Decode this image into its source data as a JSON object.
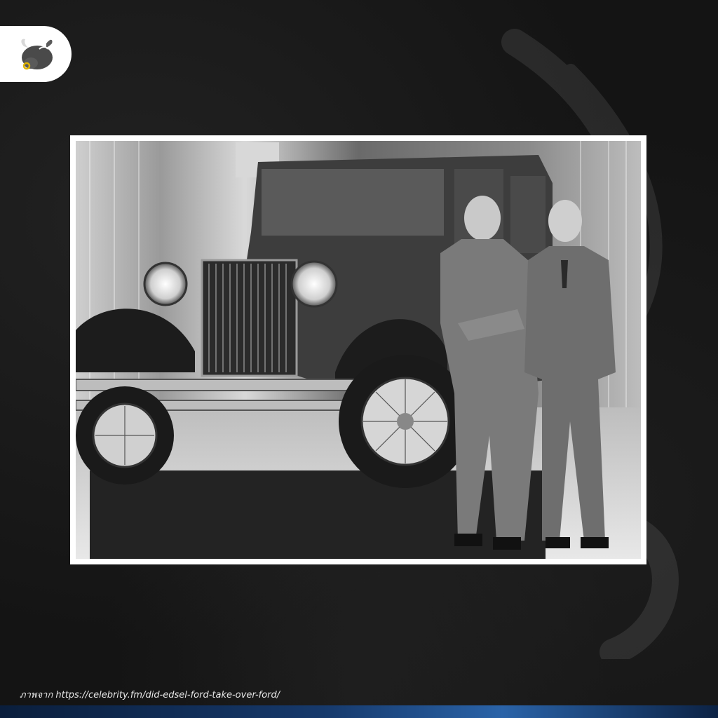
{
  "brand": {
    "logo_icon": "bull-logo-icon"
  },
  "photo": {
    "subject": "historical-photo",
    "tone": "black-and-white"
  },
  "caption": {
    "text": "ภาพจาก https://celebrity.fm/did-edsel-ford-take-over-ford/"
  },
  "colors": {
    "background": "#141414",
    "frame": "#ffffff",
    "accent_bar": "#2a63a8"
  }
}
